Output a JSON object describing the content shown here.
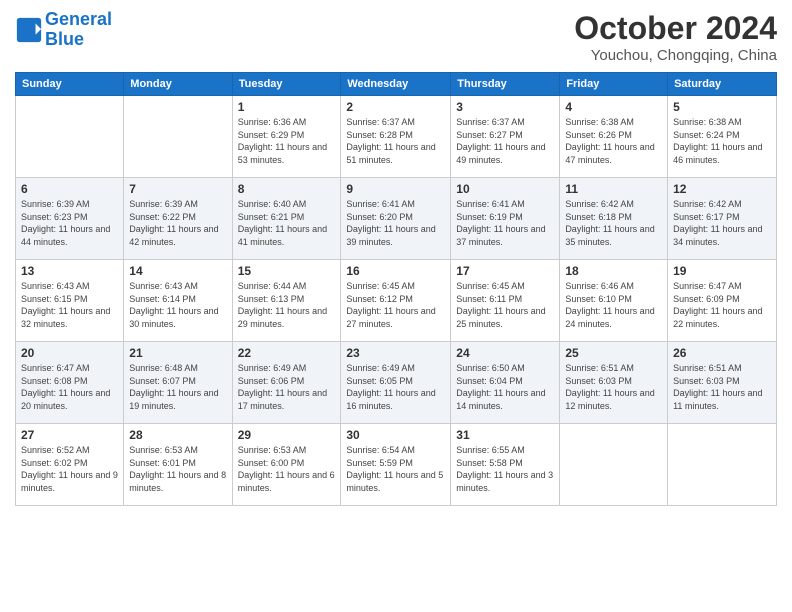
{
  "header": {
    "logo_line1": "General",
    "logo_line2": "Blue",
    "month_title": "October 2024",
    "location": "Youchou, Chongqing, China"
  },
  "weekdays": [
    "Sunday",
    "Monday",
    "Tuesday",
    "Wednesday",
    "Thursday",
    "Friday",
    "Saturday"
  ],
  "weeks": [
    [
      {
        "day": "",
        "info": ""
      },
      {
        "day": "",
        "info": ""
      },
      {
        "day": "1",
        "info": "Sunrise: 6:36 AM\nSunset: 6:29 PM\nDaylight: 11 hours and 53 minutes."
      },
      {
        "day": "2",
        "info": "Sunrise: 6:37 AM\nSunset: 6:28 PM\nDaylight: 11 hours and 51 minutes."
      },
      {
        "day": "3",
        "info": "Sunrise: 6:37 AM\nSunset: 6:27 PM\nDaylight: 11 hours and 49 minutes."
      },
      {
        "day": "4",
        "info": "Sunrise: 6:38 AM\nSunset: 6:26 PM\nDaylight: 11 hours and 47 minutes."
      },
      {
        "day": "5",
        "info": "Sunrise: 6:38 AM\nSunset: 6:24 PM\nDaylight: 11 hours and 46 minutes."
      }
    ],
    [
      {
        "day": "6",
        "info": "Sunrise: 6:39 AM\nSunset: 6:23 PM\nDaylight: 11 hours and 44 minutes."
      },
      {
        "day": "7",
        "info": "Sunrise: 6:39 AM\nSunset: 6:22 PM\nDaylight: 11 hours and 42 minutes."
      },
      {
        "day": "8",
        "info": "Sunrise: 6:40 AM\nSunset: 6:21 PM\nDaylight: 11 hours and 41 minutes."
      },
      {
        "day": "9",
        "info": "Sunrise: 6:41 AM\nSunset: 6:20 PM\nDaylight: 11 hours and 39 minutes."
      },
      {
        "day": "10",
        "info": "Sunrise: 6:41 AM\nSunset: 6:19 PM\nDaylight: 11 hours and 37 minutes."
      },
      {
        "day": "11",
        "info": "Sunrise: 6:42 AM\nSunset: 6:18 PM\nDaylight: 11 hours and 35 minutes."
      },
      {
        "day": "12",
        "info": "Sunrise: 6:42 AM\nSunset: 6:17 PM\nDaylight: 11 hours and 34 minutes."
      }
    ],
    [
      {
        "day": "13",
        "info": "Sunrise: 6:43 AM\nSunset: 6:15 PM\nDaylight: 11 hours and 32 minutes."
      },
      {
        "day": "14",
        "info": "Sunrise: 6:43 AM\nSunset: 6:14 PM\nDaylight: 11 hours and 30 minutes."
      },
      {
        "day": "15",
        "info": "Sunrise: 6:44 AM\nSunset: 6:13 PM\nDaylight: 11 hours and 29 minutes."
      },
      {
        "day": "16",
        "info": "Sunrise: 6:45 AM\nSunset: 6:12 PM\nDaylight: 11 hours and 27 minutes."
      },
      {
        "day": "17",
        "info": "Sunrise: 6:45 AM\nSunset: 6:11 PM\nDaylight: 11 hours and 25 minutes."
      },
      {
        "day": "18",
        "info": "Sunrise: 6:46 AM\nSunset: 6:10 PM\nDaylight: 11 hours and 24 minutes."
      },
      {
        "day": "19",
        "info": "Sunrise: 6:47 AM\nSunset: 6:09 PM\nDaylight: 11 hours and 22 minutes."
      }
    ],
    [
      {
        "day": "20",
        "info": "Sunrise: 6:47 AM\nSunset: 6:08 PM\nDaylight: 11 hours and 20 minutes."
      },
      {
        "day": "21",
        "info": "Sunrise: 6:48 AM\nSunset: 6:07 PM\nDaylight: 11 hours and 19 minutes."
      },
      {
        "day": "22",
        "info": "Sunrise: 6:49 AM\nSunset: 6:06 PM\nDaylight: 11 hours and 17 minutes."
      },
      {
        "day": "23",
        "info": "Sunrise: 6:49 AM\nSunset: 6:05 PM\nDaylight: 11 hours and 16 minutes."
      },
      {
        "day": "24",
        "info": "Sunrise: 6:50 AM\nSunset: 6:04 PM\nDaylight: 11 hours and 14 minutes."
      },
      {
        "day": "25",
        "info": "Sunrise: 6:51 AM\nSunset: 6:03 PM\nDaylight: 11 hours and 12 minutes."
      },
      {
        "day": "26",
        "info": "Sunrise: 6:51 AM\nSunset: 6:03 PM\nDaylight: 11 hours and 11 minutes."
      }
    ],
    [
      {
        "day": "27",
        "info": "Sunrise: 6:52 AM\nSunset: 6:02 PM\nDaylight: 11 hours and 9 minutes."
      },
      {
        "day": "28",
        "info": "Sunrise: 6:53 AM\nSunset: 6:01 PM\nDaylight: 11 hours and 8 minutes."
      },
      {
        "day": "29",
        "info": "Sunrise: 6:53 AM\nSunset: 6:00 PM\nDaylight: 11 hours and 6 minutes."
      },
      {
        "day": "30",
        "info": "Sunrise: 6:54 AM\nSunset: 5:59 PM\nDaylight: 11 hours and 5 minutes."
      },
      {
        "day": "31",
        "info": "Sunrise: 6:55 AM\nSunset: 5:58 PM\nDaylight: 11 hours and 3 minutes."
      },
      {
        "day": "",
        "info": ""
      },
      {
        "day": "",
        "info": ""
      }
    ]
  ]
}
